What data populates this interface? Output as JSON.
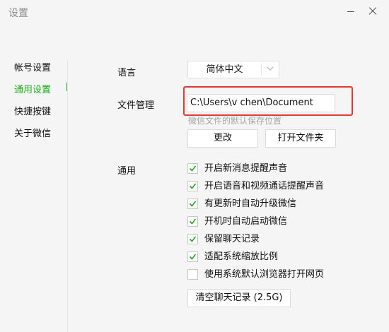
{
  "window": {
    "title": "设置"
  },
  "sidebar": {
    "items": [
      {
        "label": "帐号设置"
      },
      {
        "label": "通用设置",
        "active": true
      },
      {
        "label": "快捷按键"
      },
      {
        "label": "关于微信"
      }
    ]
  },
  "language": {
    "label": "语言",
    "selected": "简体中文"
  },
  "file_management": {
    "label": "文件管理",
    "path_value": "C:\\Users\\v      chen\\Document",
    "hint": "微信文件的默认保存位置",
    "change_button": "更改",
    "open_folder_button": "打开文件夹"
  },
  "general": {
    "label": "通用",
    "options": [
      {
        "label": "开启新消息提醒声音",
        "checked": true
      },
      {
        "label": "开启语音和视频通话提醒声音",
        "checked": true
      },
      {
        "label": "有更新时自动升级微信",
        "checked": true
      },
      {
        "label": "开机时自动启动微信",
        "checked": true
      },
      {
        "label": "保留聊天记录",
        "checked": true
      },
      {
        "label": "适配系统缩放比例",
        "checked": true
      },
      {
        "label": "使用系统默认浏览器打开网页",
        "checked": false
      }
    ],
    "clear_button": "清空聊天记录 (2.5G)"
  },
  "colors": {
    "accent": "#1aad19",
    "highlight_border": "#e23b33"
  }
}
